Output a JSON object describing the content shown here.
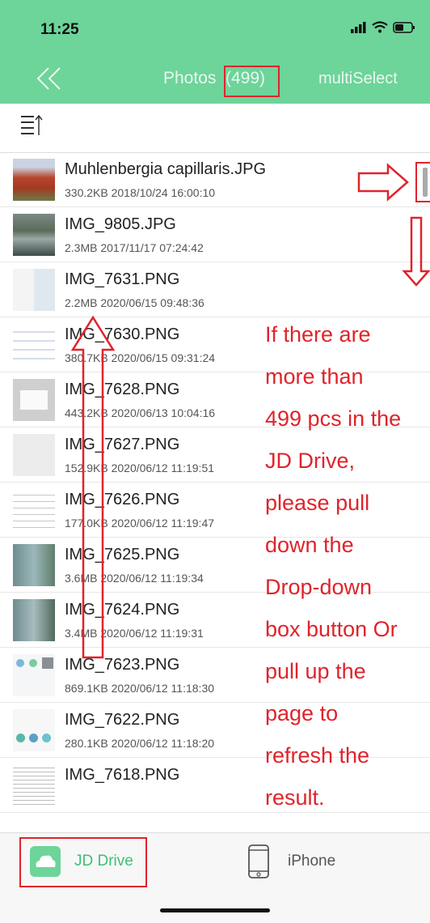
{
  "status_bar": {
    "time": "11:25"
  },
  "navbar": {
    "title": "Photos",
    "count": "(499)",
    "multi_select": "multiSelect"
  },
  "files": [
    {
      "name": "Muhlenbergia capillaris.JPG",
      "meta": "330.2KB 2018/10/24 16:00:10"
    },
    {
      "name": "IMG_9805.JPG",
      "meta": "2.3MB 2017/11/17 07:24:42"
    },
    {
      "name": "IMG_7631.PNG",
      "meta": "2.2MB 2020/06/15 09:48:36"
    },
    {
      "name": "IMG_7630.PNG",
      "meta": "380.7KB 2020/06/15 09:31:24"
    },
    {
      "name": "IMG_7628.PNG",
      "meta": "443.2KB 2020/06/13 10:04:16"
    },
    {
      "name": "IMG_7627.PNG",
      "meta": "152.9KB 2020/06/12 11:19:51"
    },
    {
      "name": "IMG_7626.PNG",
      "meta": "177.0KB 2020/06/12 11:19:47"
    },
    {
      "name": "IMG_7625.PNG",
      "meta": "3.6MB 2020/06/12 11:19:34"
    },
    {
      "name": "IMG_7624.PNG",
      "meta": "3.4MB 2020/06/12 11:19:31"
    },
    {
      "name": "IMG_7623.PNG",
      "meta": "869.1KB 2020/06/12 11:18:30"
    },
    {
      "name": "IMG_7622.PNG",
      "meta": "280.1KB 2020/06/12 11:18:20"
    },
    {
      "name": "IMG_7618.PNG",
      "meta": ""
    }
  ],
  "annotation": {
    "lines": [
      "If there are",
      "more than",
      "499 pcs in the",
      "JD Drive,",
      "please pull",
      "down the",
      "Drop-down",
      "box button Or",
      "pull up the",
      "page to",
      "refresh the",
      "result."
    ]
  },
  "tabbar": {
    "jd_drive": "JD Drive",
    "iphone": "iPhone"
  },
  "colors": {
    "accent": "#6dd49a",
    "annotation_red": "#e0232b"
  }
}
